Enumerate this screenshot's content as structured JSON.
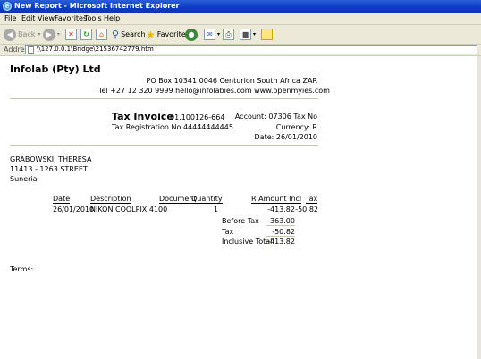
{
  "window": {
    "title": "New Report - Microsoft Internet Explorer"
  },
  "menu": [
    "File",
    "Edit",
    "View",
    "Favorites",
    "Tools",
    "Help"
  ],
  "toolbar": {
    "back": "Back",
    "search": "Search",
    "favorites": "Favorites"
  },
  "address": {
    "label": "Address",
    "url": "\\\\127.0.0.1\\Bridge\\21536742779.htm"
  },
  "company": {
    "name": "Infolab (Pty) Ltd",
    "address": "PO Box 10341 0046 Centurion South Africa ZAR",
    "contact": "Tel +27 12 320 9999 hello@infolabies.com www.openmyies.com"
  },
  "invoice": {
    "title": "Tax Invoice",
    "number": "01.100126-664",
    "tax_reg": "Tax Registration No 44444444445",
    "account": "Account: 07306 Tax No",
    "currency": "Currency: R",
    "date": "Date: 26/01/2010"
  },
  "customer": {
    "name": "GRABOWSKI, THERESA",
    "street": "11413 - 1263 STREET",
    "suburb": "Suneria"
  },
  "table": {
    "headers": {
      "date": "Date",
      "description": "Description",
      "document": "Document",
      "quantity": "Quantity",
      "amount": "R Amount Incl",
      "tax": "Tax"
    },
    "rows": [
      {
        "date": "26/01/2010",
        "description": "NIKON COOLPIX 4100",
        "quantity": "1",
        "amount": "-413.82",
        "tax": "-50.82"
      }
    ]
  },
  "totals": {
    "before_tax_label": "Before Tax",
    "before_tax": "-363.00",
    "tax_label": "Tax",
    "tax": "-50.82",
    "inclusive_label": "Inclusive Total",
    "inclusive": "-413.82"
  },
  "terms": "Terms:"
}
